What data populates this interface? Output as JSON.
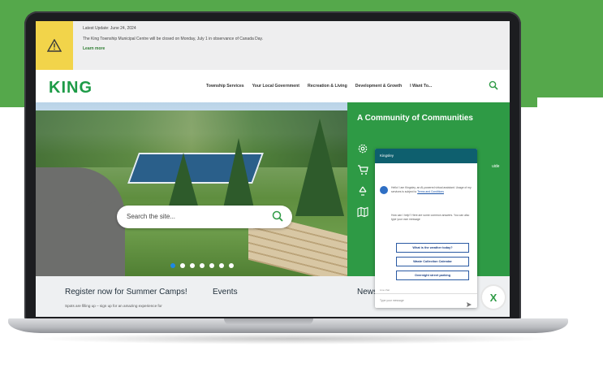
{
  "colors": {
    "brand_green": "#2e9a45",
    "background_green": "#55a84b",
    "alert_yellow": "#f2d44a",
    "chat_header": "#0e5f6e"
  },
  "alert": {
    "date_line": "Latest Update: June 24, 2024",
    "message": "The King Township Municipal Centre will be closed on Monday, July 1 in observance of Canada Day.",
    "link": "Learn more",
    "icon": "warning-icon"
  },
  "nav": {
    "logo": "KING",
    "links": [
      "Township Services",
      "Your Local Government",
      "Recreation & Living",
      "Development & Growth",
      "I Want To..."
    ],
    "search_icon": "search-icon"
  },
  "hero": {
    "search_placeholder": "Search the site...",
    "slide_count": 7,
    "active_slide": 1
  },
  "panel": {
    "title": "A Community of Communities",
    "side_text": "uide",
    "icons": [
      "gear-icon",
      "cart-icon",
      "recycle-icon",
      "map-icon"
    ]
  },
  "chat": {
    "header": "Kingsley",
    "intro": "Hello! I am Kingsley, an AI-powered virtual assistant. Usage of my services is subject to",
    "intro_link": "Terms and Conditions",
    "prompt": "How can I help? Here are some common answers. You can also type your own message",
    "buttons": [
      "What is the weather today?",
      "Waste Collection Calendar",
      "Overnight street parking"
    ],
    "powered": "Live chat",
    "input_placeholder": "Type your message",
    "send_icon": "send-icon"
  },
  "content": {
    "camps_title": "Register now for Summer Camps!",
    "camps_sub": "Spots are filling up – sign up for an amazing experience for",
    "events_title": "Events",
    "news_title": "News"
  },
  "close_label": "X"
}
